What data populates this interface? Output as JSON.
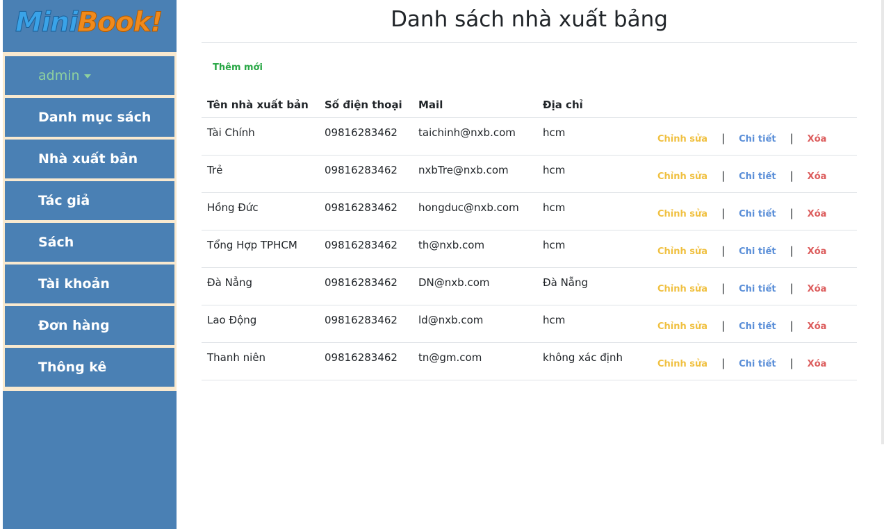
{
  "brand": {
    "part1": "Mini",
    "part2": "Book!"
  },
  "sidebar": {
    "user": "admin",
    "items": [
      {
        "label": "Danh mục sách"
      },
      {
        "label": "Nhà xuất bản"
      },
      {
        "label": "Tác giả"
      },
      {
        "label": "Sách"
      },
      {
        "label": "Tài khoản"
      },
      {
        "label": "Đơn hàng"
      },
      {
        "label": "Thông kê"
      }
    ]
  },
  "main": {
    "title": "Danh sách nhà xuất bảng",
    "add_label": "Thêm mới",
    "columns": [
      "Tên nhà xuất bản",
      "Số điện thoại",
      "Mail",
      "Địa chỉ"
    ],
    "actions": {
      "edit": "Chỉnh sửa",
      "detail": "Chi tiết",
      "delete": "Xóa",
      "separator": "|"
    },
    "rows": [
      {
        "name": "Tài Chính",
        "phone": "09816283462",
        "mail": "taichinh@nxb.com",
        "address": "hcm"
      },
      {
        "name": "Trẻ",
        "phone": "09816283462",
        "mail": "nxbTre@nxb.com",
        "address": "hcm"
      },
      {
        "name": "Hồng Đức",
        "phone": "09816283462",
        "mail": "hongduc@nxb.com",
        "address": "hcm"
      },
      {
        "name": "Tổng Hợp TPHCM",
        "phone": "09816283462",
        "mail": "th@nxb.com",
        "address": "hcm"
      },
      {
        "name": "Đà Nẳng",
        "phone": "09816283462",
        "mail": "DN@nxb.com",
        "address": "Đà Nẵng"
      },
      {
        "name": "Lao Động",
        "phone": "09816283462",
        "mail": "ld@nxb.com",
        "address": "hcm"
      },
      {
        "name": "Thanh niên",
        "phone": "09816283462",
        "mail": "tn@gm.com",
        "address": "không xác định"
      }
    ]
  },
  "colors": {
    "sidebar": "#4a80b4",
    "menu_border": "#f9e9cf",
    "add": "#28a745",
    "edit": "#f0c040",
    "detail": "#5b8fd8",
    "delete": "#dc5c5c"
  }
}
